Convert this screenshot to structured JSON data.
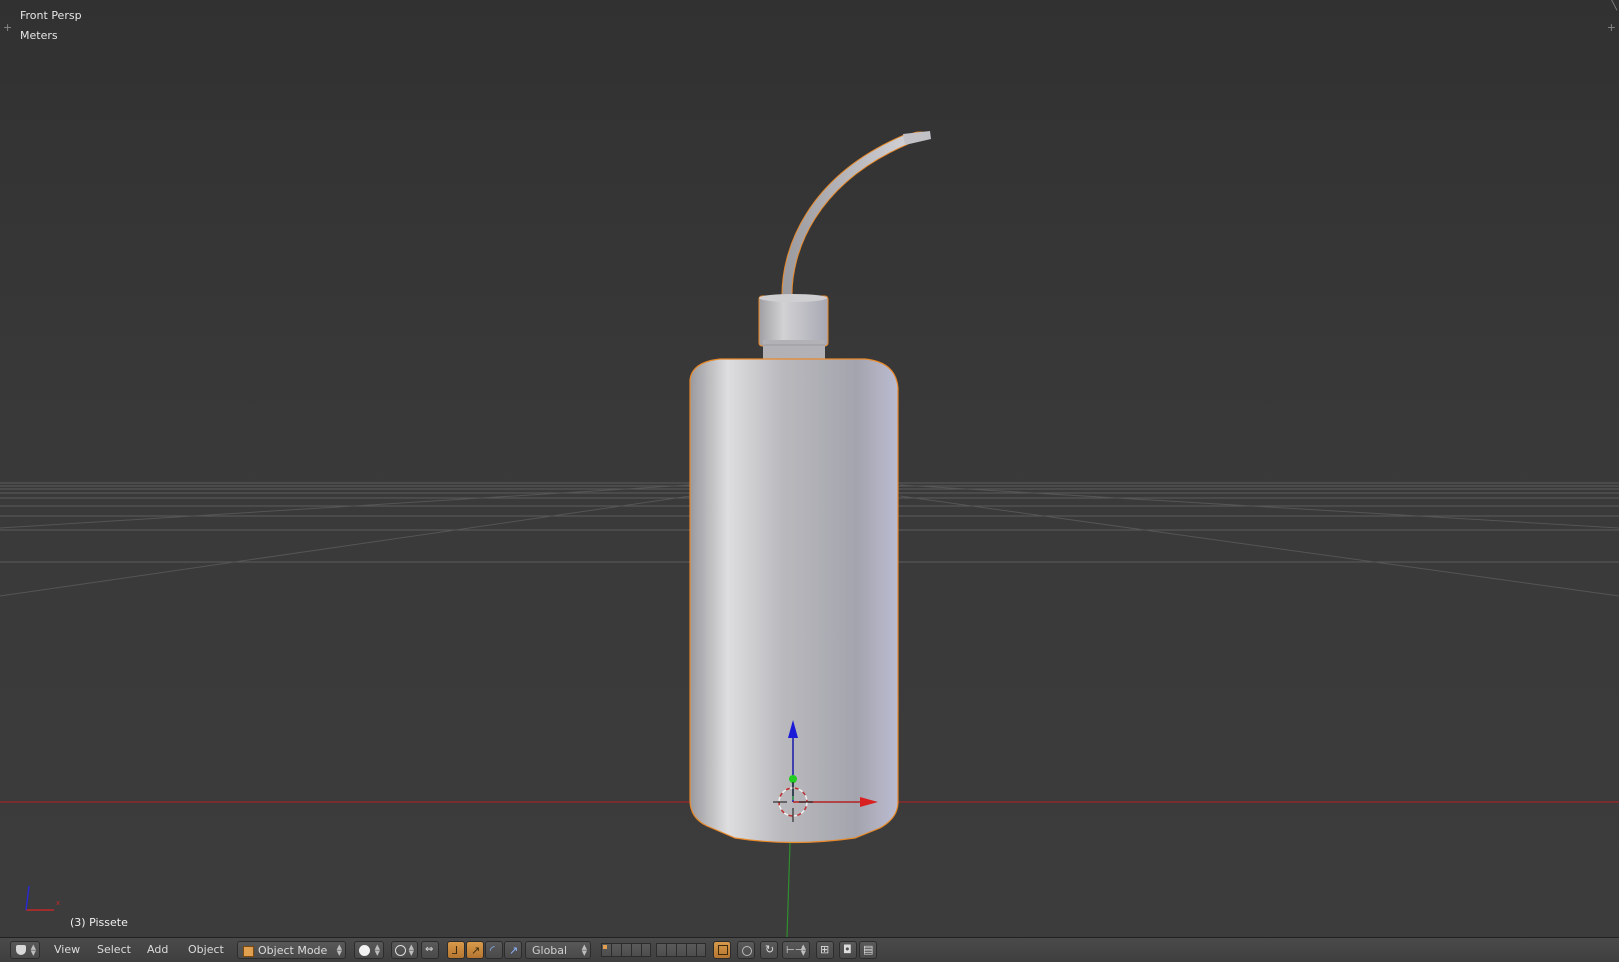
{
  "viewport": {
    "view_name": "Front Persp",
    "units": "Meters",
    "object_info": "(3) Pissete",
    "colors": {
      "background": "#393939",
      "grid_line": "#5a5a5a",
      "x_axis": "#a52a2a",
      "y_axis": "#2e8b2e",
      "selection_outline": "#e8892a",
      "bottle": "#c4c4c8"
    }
  },
  "toolbar": {
    "editor_type_icon": "3d-view-icon",
    "menus": [
      "View",
      "Select",
      "Add",
      "Object"
    ],
    "mode": "Object Mode",
    "mode_icon": "object-mode-cube-icon",
    "shading_icon": "solid-sphere-icon",
    "pivot_icon": "pivot-point-icon",
    "manipulator_icons": [
      "translate-icon",
      "rotate-icon",
      "scale-icon"
    ],
    "orientation": "Global",
    "accent": "#d08a3a"
  }
}
